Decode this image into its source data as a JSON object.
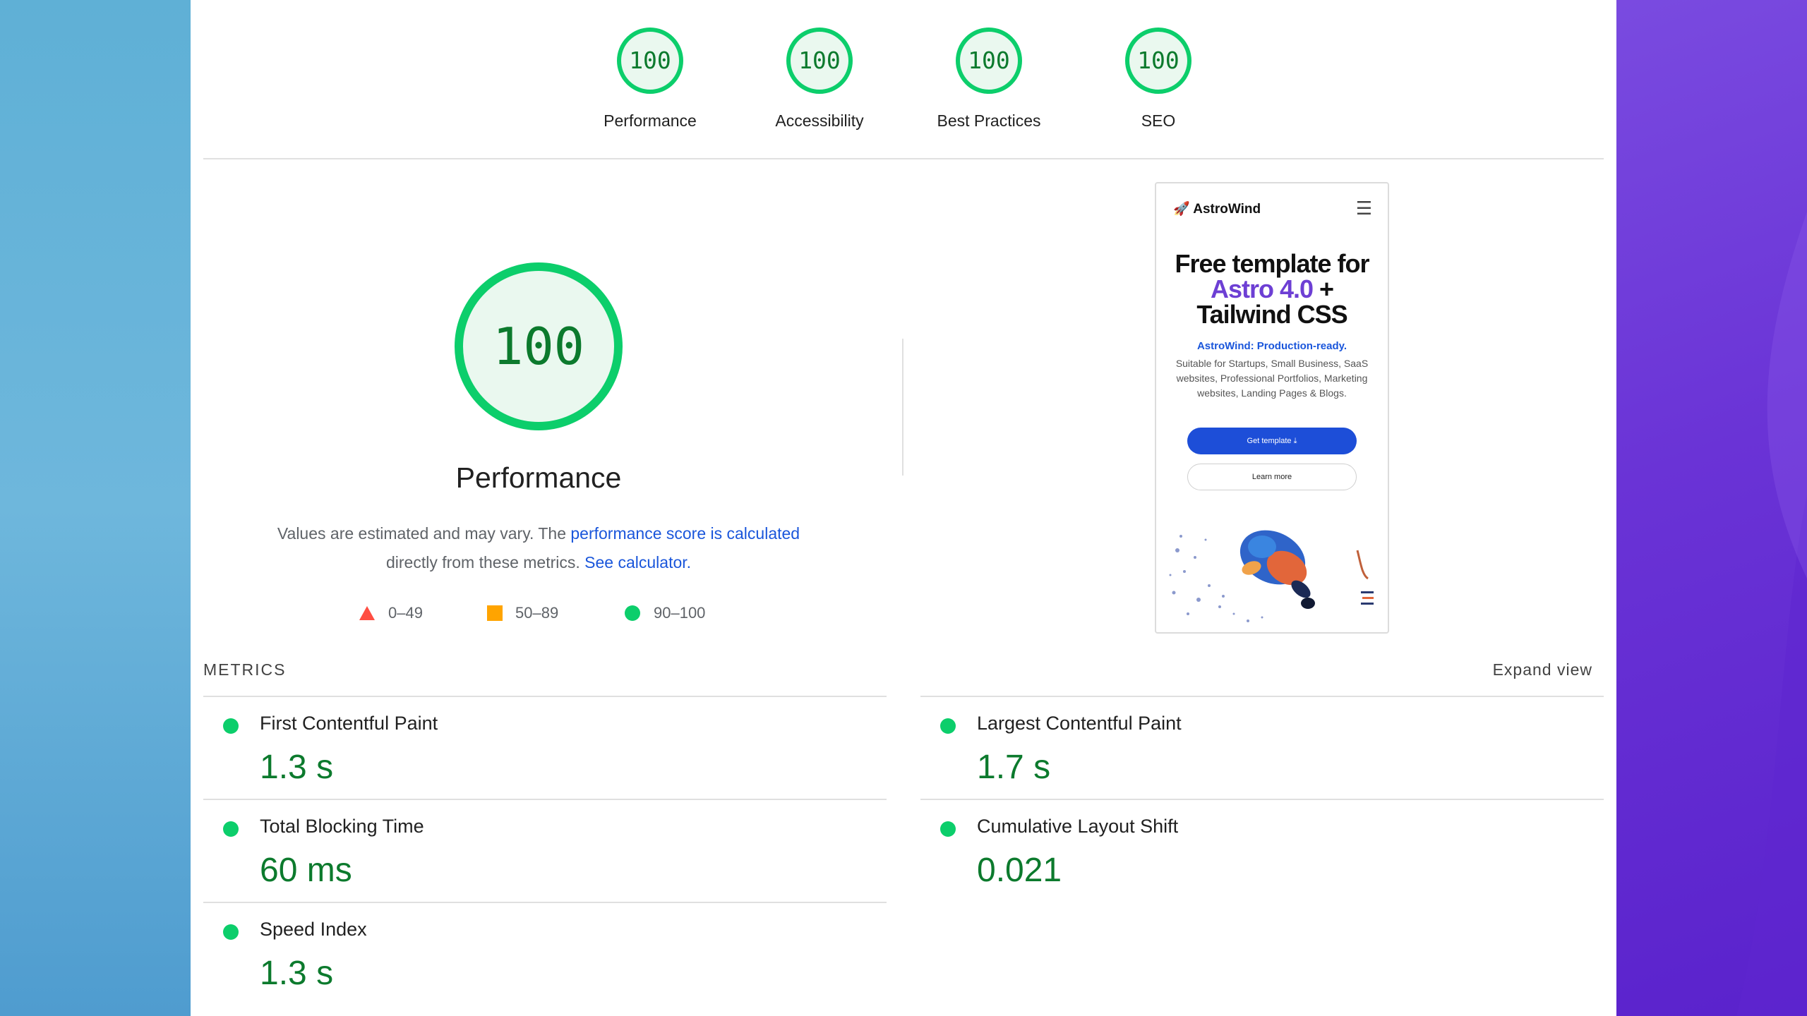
{
  "colors": {
    "pass": "#0cce6b",
    "pass_text": "#0c7a2d",
    "fail": "#ff4e42",
    "average": "#ffa400",
    "link": "#1a56db"
  },
  "categories": [
    {
      "label": "Performance",
      "score": "100"
    },
    {
      "label": "Accessibility",
      "score": "100"
    },
    {
      "label": "Best Practices",
      "score": "100"
    },
    {
      "label": "SEO",
      "score": "100"
    }
  ],
  "main": {
    "score": "100",
    "title": "Performance",
    "desc_part1": "Values are estimated and may vary. The ",
    "desc_link1": "performance score is calculated",
    "desc_part2": "directly from these metrics. ",
    "desc_link2": "See calculator.",
    "legend": [
      {
        "shape": "triangle-icon",
        "range": "0–49"
      },
      {
        "shape": "square-icon",
        "range": "50–89"
      },
      {
        "shape": "circle-icon",
        "range": "90–100"
      }
    ]
  },
  "preview": {
    "brand": "🚀 AstroWind",
    "menu_icon": "☰",
    "headline_1": "Free template for",
    "headline_highlight": "Astro 4.0",
    "headline_plus": " +",
    "headline_3": "Tailwind CSS",
    "subtitle": "AstroWind: Production-ready.",
    "description": "Suitable for Startups, Small Business, SaaS websites, Professional Portfolios, Marketing websites, Landing Pages & Blogs.",
    "primary_button": "Get template ⤓",
    "secondary_button": "Learn more"
  },
  "metrics": {
    "section_label": "METRICS",
    "expand_label": "Expand view",
    "items": [
      {
        "name": "First Contentful Paint",
        "value": "1.3 s"
      },
      {
        "name": "Largest Contentful Paint",
        "value": "1.7 s"
      },
      {
        "name": "Total Blocking Time",
        "value": "60 ms"
      },
      {
        "name": "Cumulative Layout Shift",
        "value": "0.021"
      },
      {
        "name": "Speed Index",
        "value": "1.3 s"
      }
    ]
  }
}
